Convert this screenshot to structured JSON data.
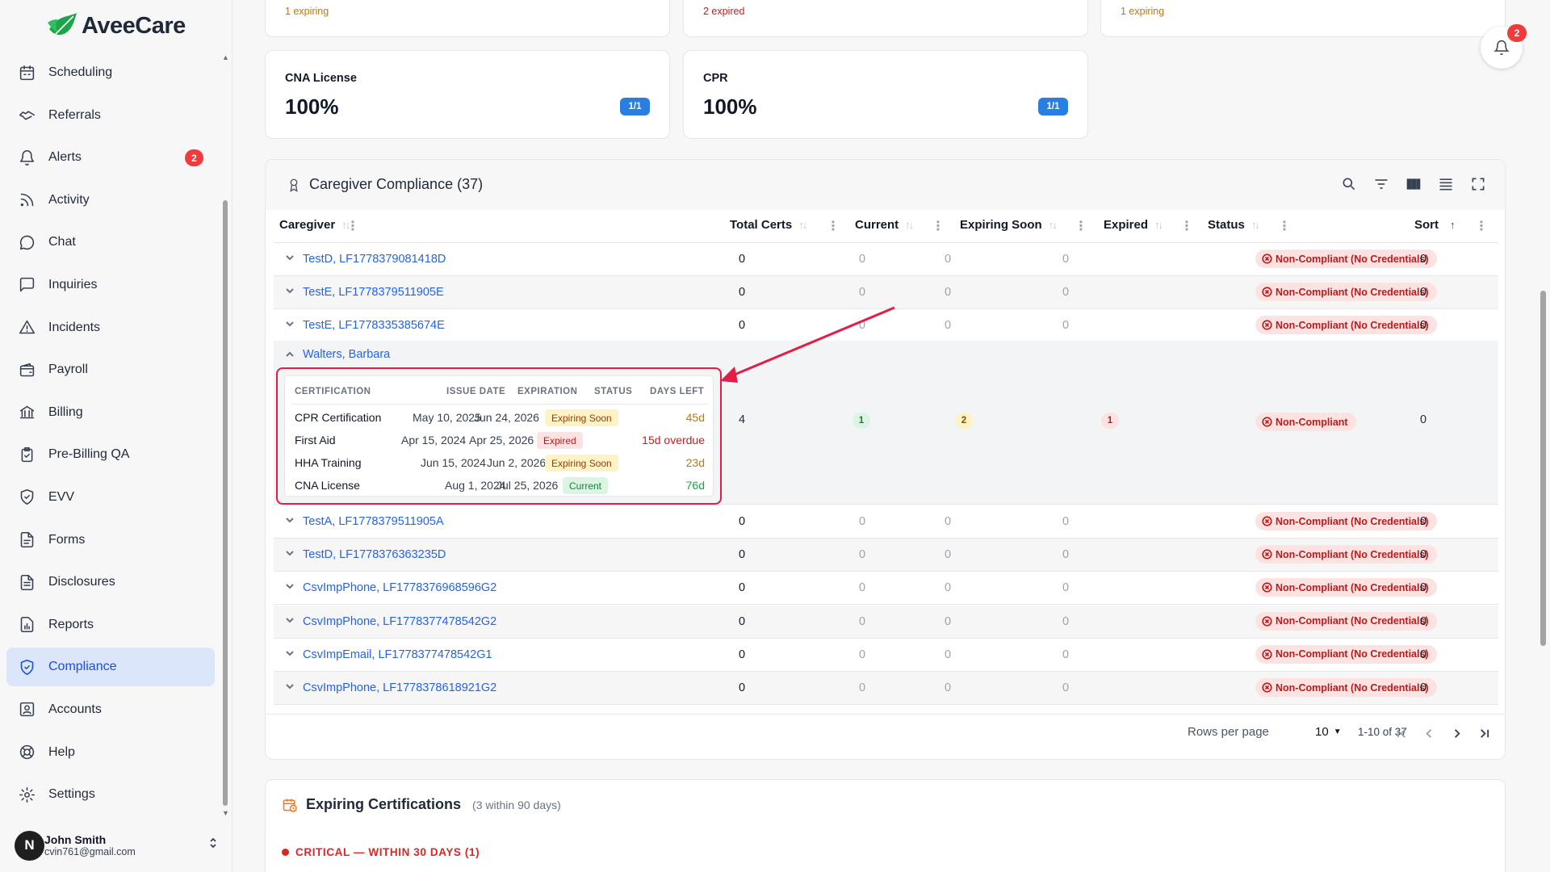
{
  "app": {
    "name": "AveeCare"
  },
  "sidebar": {
    "items": [
      {
        "key": "scheduling",
        "label": "Scheduling",
        "icon": "calendar-icon"
      },
      {
        "key": "referrals",
        "label": "Referrals",
        "icon": "handshake-icon"
      },
      {
        "key": "alerts",
        "label": "Alerts",
        "icon": "bell-icon",
        "badge": "2"
      },
      {
        "key": "activity",
        "label": "Activity",
        "icon": "rss-icon"
      },
      {
        "key": "chat",
        "label": "Chat",
        "icon": "chat-icon"
      },
      {
        "key": "inquiries",
        "label": "Inquiries",
        "icon": "message-square-icon"
      },
      {
        "key": "incidents",
        "label": "Incidents",
        "icon": "warning-triangle-icon"
      },
      {
        "key": "payroll",
        "label": "Payroll",
        "icon": "wallet-icon"
      },
      {
        "key": "billing",
        "label": "Billing",
        "icon": "bank-icon"
      },
      {
        "key": "pre-billing-qa",
        "label": "Pre-Billing QA",
        "icon": "clipboard-check-icon"
      },
      {
        "key": "evv",
        "label": "EVV",
        "icon": "shield-check-icon"
      },
      {
        "key": "forms",
        "label": "Forms",
        "icon": "file-text-icon"
      },
      {
        "key": "disclosures",
        "label": "Disclosures",
        "icon": "document-icon"
      },
      {
        "key": "reports",
        "label": "Reports",
        "icon": "report-icon"
      },
      {
        "key": "compliance",
        "label": "Compliance",
        "icon": "shield-icon",
        "active": true
      },
      {
        "key": "accounts",
        "label": "Accounts",
        "icon": "contact-icon"
      },
      {
        "key": "help",
        "label": "Help",
        "icon": "lifebuoy-icon"
      },
      {
        "key": "settings",
        "label": "Settings",
        "icon": "gear-icon"
      }
    ],
    "user": {
      "initial": "N",
      "name": "John Smith",
      "email": "cvin761@gmail.com"
    }
  },
  "notifications": {
    "count": "2"
  },
  "stats_top": [
    {
      "text": "1 expiring",
      "tone": "orange"
    },
    {
      "text": "2 expired",
      "tone": "red"
    },
    {
      "text": "1 expiring",
      "tone": "orange"
    }
  ],
  "stats": [
    {
      "title": "CNA License",
      "value": "100%",
      "pill": "1/1"
    },
    {
      "title": "CPR",
      "value": "100%",
      "pill": "1/1"
    }
  ],
  "compliance_table": {
    "title": "Caregiver Compliance (37)",
    "columns": [
      "Caregiver",
      "Total Certs",
      "Current",
      "Expiring Soon",
      "Expired",
      "Status",
      "Sort"
    ],
    "rows": [
      {
        "name": "TestD, LF1778379081418D",
        "total": "0",
        "current": "0",
        "soon": "0",
        "expired": "0",
        "status": "Non-Compliant (No Credentials)",
        "sort": "0"
      },
      {
        "name": "TestE, LF1778379511905E",
        "total": "0",
        "current": "0",
        "soon": "0",
        "expired": "0",
        "status": "Non-Compliant (No Credentials)",
        "sort": "0"
      },
      {
        "name": "TestE, LF1778335385674E",
        "total": "0",
        "current": "0",
        "soon": "0",
        "expired": "0",
        "status": "Non-Compliant (No Credentials)",
        "sort": "0"
      }
    ],
    "expanded": {
      "name": "Walters, Barbara",
      "total": "4",
      "current": "1",
      "soon": "2",
      "expired": "1",
      "status": "Non-Compliant",
      "sort": "0",
      "cert_headers": [
        "CERTIFICATION",
        "ISSUE DATE",
        "EXPIRATION",
        "STATUS",
        "DAYS LEFT"
      ],
      "certs": [
        {
          "name": "CPR Certification",
          "issue": "May 10, 2025",
          "expiration": "Jun 24, 2026",
          "status": "Expiring Soon",
          "days": "45d"
        },
        {
          "name": "First Aid",
          "issue": "Apr 15, 2024",
          "expiration": "Apr 25, 2026",
          "status": "Expired",
          "days": "15d overdue"
        },
        {
          "name": "HHA Training",
          "issue": "Jun 15, 2024",
          "expiration": "Jun 2, 2026",
          "status": "Expiring Soon",
          "days": "23d"
        },
        {
          "name": "CNA License",
          "issue": "Aug 1, 2024",
          "expiration": "Jul 25, 2026",
          "status": "Current",
          "days": "76d"
        }
      ]
    },
    "rows_after": [
      {
        "name": "TestA, LF1778379511905A",
        "total": "0",
        "current": "0",
        "soon": "0",
        "expired": "0",
        "status": "Non-Compliant (No Credentials)",
        "sort": "0"
      },
      {
        "name": "TestD, LF1778376363235D",
        "total": "0",
        "current": "0",
        "soon": "0",
        "expired": "0",
        "status": "Non-Compliant (No Credentials)",
        "sort": "0"
      },
      {
        "name": "CsvImpPhone, LF1778376968596G2",
        "total": "0",
        "current": "0",
        "soon": "0",
        "expired": "0",
        "status": "Non-Compliant (No Credentials)",
        "sort": "0"
      },
      {
        "name": "CsvImpPhone, LF1778377478542G2",
        "total": "0",
        "current": "0",
        "soon": "0",
        "expired": "0",
        "status": "Non-Compliant (No Credentials)",
        "sort": "0"
      },
      {
        "name": "CsvImpEmail, LF1778377478542G1",
        "total": "0",
        "current": "0",
        "soon": "0",
        "expired": "0",
        "status": "Non-Compliant (No Credentials)",
        "sort": "0"
      },
      {
        "name": "CsvImpPhone, LF1778378618921G2",
        "total": "0",
        "current": "0",
        "soon": "0",
        "expired": "0",
        "status": "Non-Compliant (No Credentials)",
        "sort": "0"
      }
    ],
    "pager": {
      "rows_label": "Rows per page",
      "rows_value": "10",
      "range": "1-10 of 37"
    }
  },
  "expiring": {
    "title": "Expiring Certifications",
    "subtitle": "(3 within 90 days)",
    "critical": "CRITICAL — WITHIN 30 DAYS (1)"
  }
}
